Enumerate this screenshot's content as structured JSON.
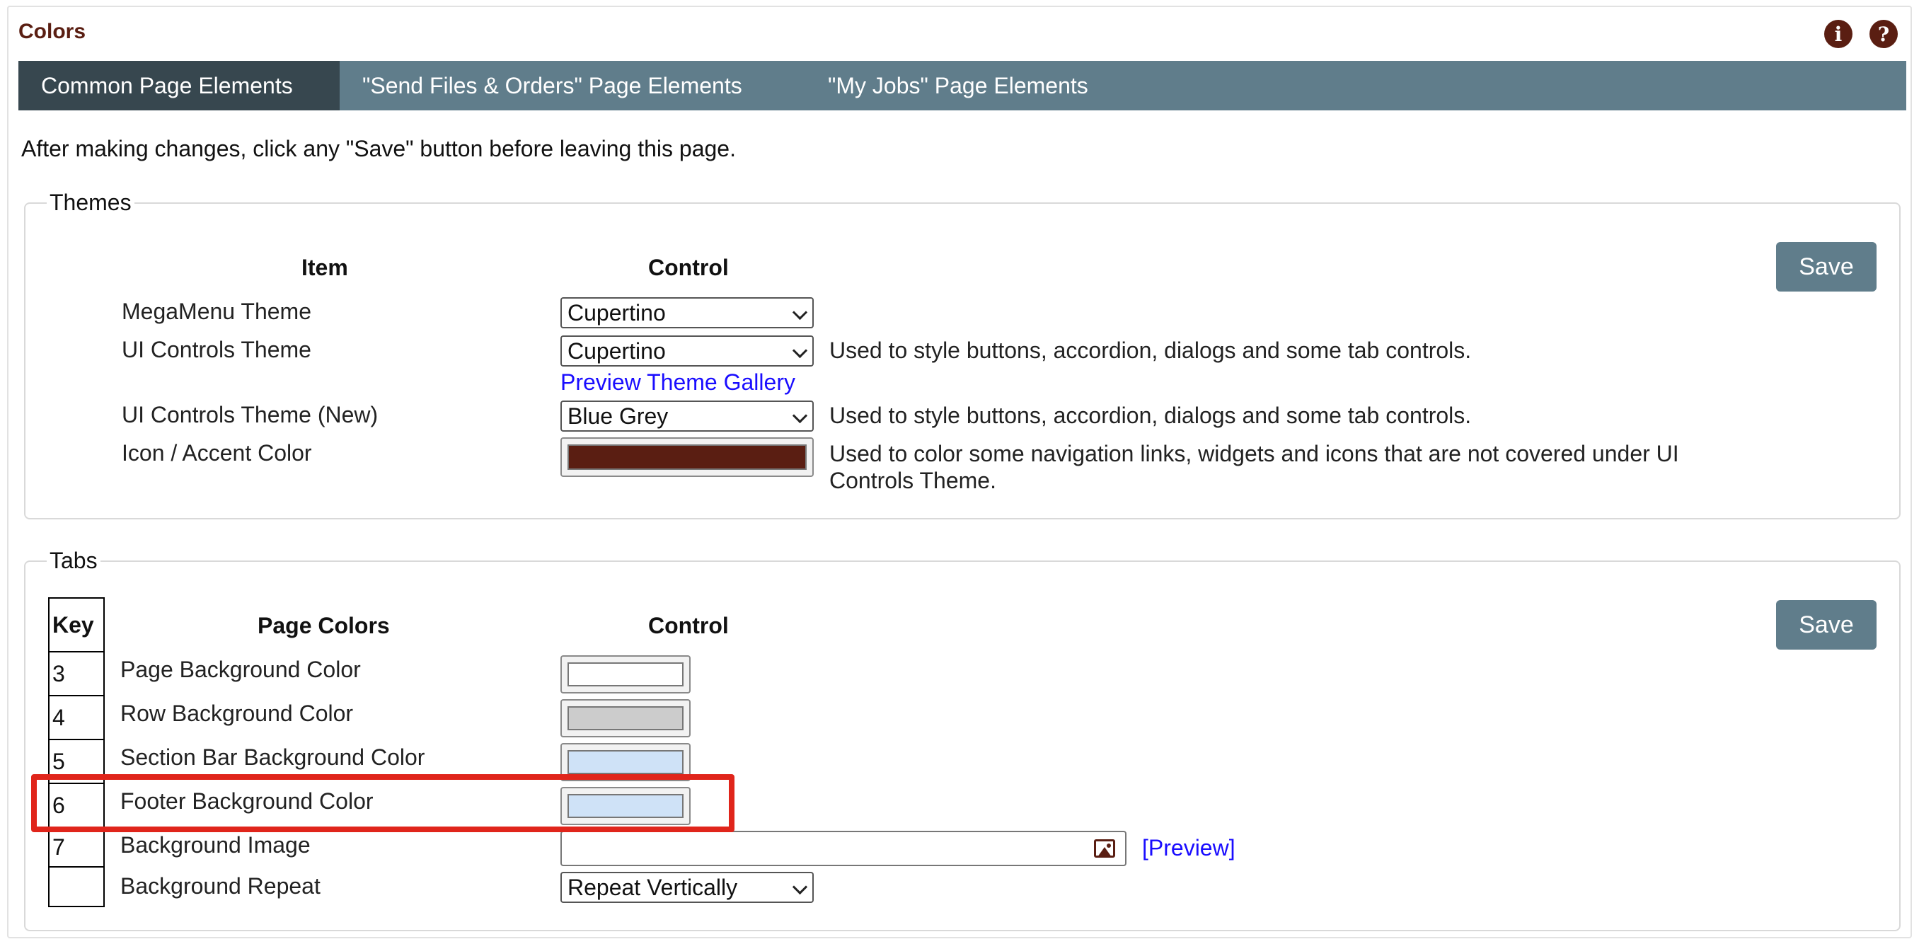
{
  "page": {
    "title": "Colors",
    "info_icon": "info-icon",
    "help_icon": "help-icon",
    "notice": "After making changes, click any \"Save\" button before leaving this page."
  },
  "tabs": [
    {
      "label": "Common Page Elements",
      "active": true
    },
    {
      "label": "\"Send Files & Orders\" Page Elements",
      "active": false
    },
    {
      "label": "\"My Jobs\" Page Elements",
      "active": false
    }
  ],
  "themes": {
    "legend": "Themes",
    "col_item": "Item",
    "col_control": "Control",
    "save_label": "Save",
    "rows": [
      {
        "label": "MegaMenu Theme",
        "value": "Cupertino",
        "description": ""
      },
      {
        "label": "UI Controls Theme",
        "value": "Cupertino",
        "description": "Used to style buttons, accordion, dialogs and some tab controls.",
        "link": "Preview Theme Gallery"
      },
      {
        "label": "UI Controls Theme (New)",
        "value": "Blue Grey",
        "description": "Used to style buttons, accordion, dialogs and some tab controls."
      },
      {
        "label": "Icon / Accent Color",
        "color": "#5a1e12",
        "description_line1": "Used to color some navigation links, widgets and icons that are not covered under UI",
        "description_line2": "Controls Theme."
      }
    ]
  },
  "tabs_section": {
    "legend": "Tabs",
    "col_key": "Key",
    "col_page_colors": "Page Colors",
    "col_control": "Control",
    "save_label": "Save",
    "rows": [
      {
        "key": "3",
        "label": "Page Background Color",
        "color": "#ffffff"
      },
      {
        "key": "4",
        "label": "Row Background Color",
        "color": "#cccccc"
      },
      {
        "key": "5",
        "label": "Section Bar Background Color",
        "color": "#cfe2f7"
      },
      {
        "key": "6",
        "label": "Footer Background Color",
        "color": "#cfe2f7"
      },
      {
        "key": "7",
        "label": "Background Image",
        "preview_link": "[Preview]",
        "icon": "image-icon"
      },
      {
        "key": "",
        "label": "Background Repeat",
        "value": "Repeat Vertically"
      }
    ]
  },
  "colors": {
    "accent": "#5a1e12",
    "tab_bar": "#607d8b",
    "tab_active": "#37474f",
    "highlight": "#e0251b",
    "link": "#1a0dff"
  }
}
